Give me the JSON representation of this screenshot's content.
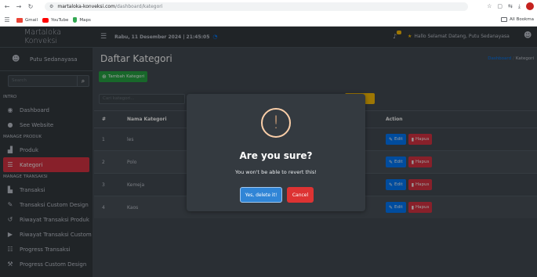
{
  "browser": {
    "url_host": "martaloka-konveksi.com",
    "url_path": "/dashboard/kategori",
    "bookmarks": [
      "Gmail",
      "YouTube",
      "Maps"
    ],
    "all_bookmarks_label": "All Bookma"
  },
  "sidebar": {
    "brand": "Martaloka Konveksi",
    "user_name": "Putu Sedanayasa",
    "search_placeholder": "Search",
    "sections": {
      "intro": "INTRO",
      "manage_produk": "MANAGE PRODUK",
      "manage_transaksi": "MANAGE TRANSAKSI"
    },
    "items": [
      {
        "label": "Dashboard",
        "icon": "dashboard-icon"
      },
      {
        "label": "See Website",
        "icon": "globe-icon"
      },
      {
        "label": "Produk",
        "icon": "shopping-bag-icon"
      },
      {
        "label": "Kategori",
        "icon": "list-icon"
      },
      {
        "label": "Transaksi",
        "icon": "cart-icon"
      },
      {
        "label": "Transaksi Custom Design",
        "icon": "brush-icon"
      },
      {
        "label": "Riwayat Transaksi Produk",
        "icon": "history-icon"
      },
      {
        "label": "Riwayat Transaksi Custom",
        "icon": "history-custom-icon"
      },
      {
        "label": "Progress Transaksi",
        "icon": "progress-list-icon"
      },
      {
        "label": "Progress Custom Design",
        "icon": "tasks-icon"
      }
    ]
  },
  "navbar": {
    "datetime": "Rabu, 11 Desember 2024 | 21:45:05",
    "greeting": "Hallo Selamat Datang, Putu Sedanayasa"
  },
  "content": {
    "title": "Daftar Kategori",
    "breadcrumb_home": "Dashboard",
    "breadcrumb_current": "Kategori",
    "add_button": "Tambah Kategori",
    "search_placeholder": "Cari kategori...",
    "table": {
      "headers": [
        "#",
        "Nama Kategori",
        "Action"
      ],
      "rows": [
        {
          "no": "1",
          "name": "les"
        },
        {
          "no": "2",
          "name": "Polo"
        },
        {
          "no": "3",
          "name": "Kemeja"
        },
        {
          "no": "4",
          "name": "Kaos"
        }
      ],
      "edit_label": "Edit",
      "delete_label": "Hapus"
    }
  },
  "modal": {
    "title": "Are you sure?",
    "text": "You won't be able to revert this!",
    "confirm": "Yes, delete it!",
    "cancel": "Cancel"
  },
  "colors": {
    "active": "#dc3545",
    "primary": "#007bff",
    "success": "#28a745",
    "warning": "#ffc107",
    "confirm": "#3085d6",
    "cancel": "#dd3333"
  }
}
